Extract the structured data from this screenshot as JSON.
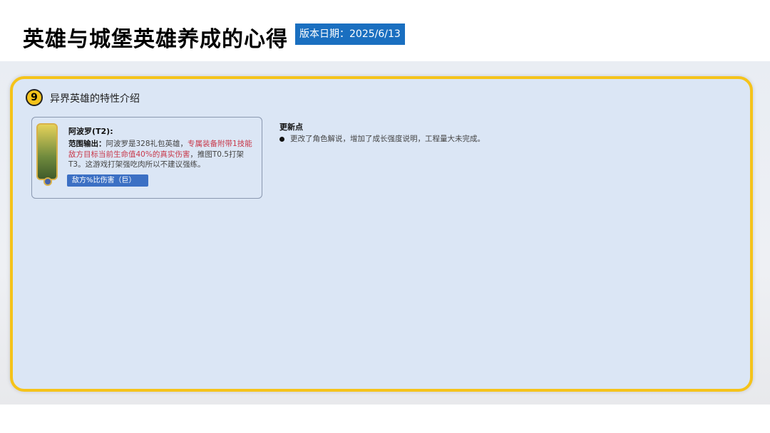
{
  "header": {
    "title": "英雄与城堡英雄养成的心得",
    "date": "版本日期：2025/6/13"
  },
  "section": {
    "number": "9",
    "title": "异界英雄的特性介绍"
  },
  "hero": {
    "name": "阿波罗(T2):",
    "role_label": "范围输出：",
    "desc_plain1": "阿波罗是328礼包英雄，",
    "desc_red": "专属装备附带1技能敌方目标当前生命值40%的真实伤害",
    "desc_plain2": "，推图T0.5打架T3。这游戏打架强吃肉所以不建议强练。",
    "tag": "敌方%比伤害（巨）"
  },
  "updates": {
    "title": "更新点",
    "items": [
      "更改了角色解说，增加了成长强度说明，工程量大未完成。"
    ]
  },
  "colors": {
    "accent": "#f5c31a",
    "date_bg": "#1a6fc0",
    "tag_bg": "#3c70c4",
    "highlight": "#c8384a"
  }
}
